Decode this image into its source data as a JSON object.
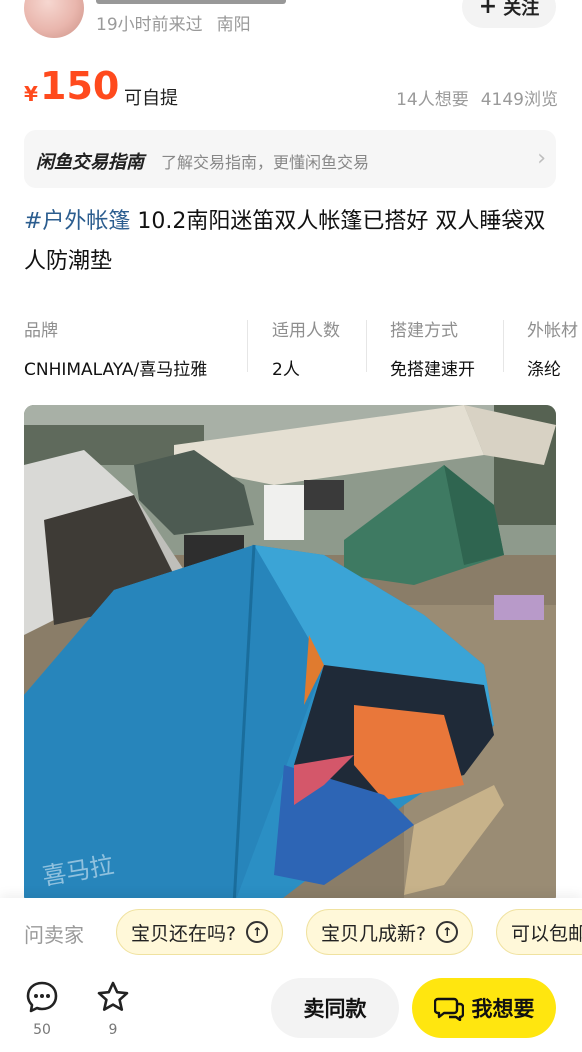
{
  "seller": {
    "last_seen": "19小时前来过",
    "location": "南阳",
    "follow_label": "关注"
  },
  "price": {
    "currency": "¥",
    "amount": "150",
    "pickup": "可自提",
    "wants": "14人想要",
    "views": "4149浏览"
  },
  "guide": {
    "title": "闲鱼交易指南",
    "text": "了解交易指南，更懂闲鱼交易"
  },
  "listing": {
    "tag": "#户外帐篷",
    "title": " 10.2南阳迷笛双人帐篷已搭好 双人睡袋双人防潮垫"
  },
  "attributes": [
    {
      "key": "品牌",
      "value": "CNHIMALAYA/喜马拉雅"
    },
    {
      "key": "适用人数",
      "value": "2人"
    },
    {
      "key": "搭建方式",
      "value": "免搭建速开"
    },
    {
      "key": "外帐材",
      "value": "涤纶"
    }
  ],
  "ask_bar": {
    "label": "问卖家",
    "chips": [
      "宝贝还在吗?",
      "宝贝几成新?",
      "可以包邮"
    ]
  },
  "bottom": {
    "comments_count": "50",
    "favorites_count": "9",
    "sell_same_label": "卖同款",
    "want_label": "我想要"
  },
  "colors": {
    "price": "#ff4a1d",
    "tag": "#2b5d8f",
    "want_button": "#ffe60f",
    "chip_bg": "#fff8d9"
  },
  "icons": [
    "plus-icon",
    "chevron-right-icon",
    "arrow-up-circle-icon",
    "comment-icon",
    "star-icon",
    "chat-bubbles-icon"
  ]
}
